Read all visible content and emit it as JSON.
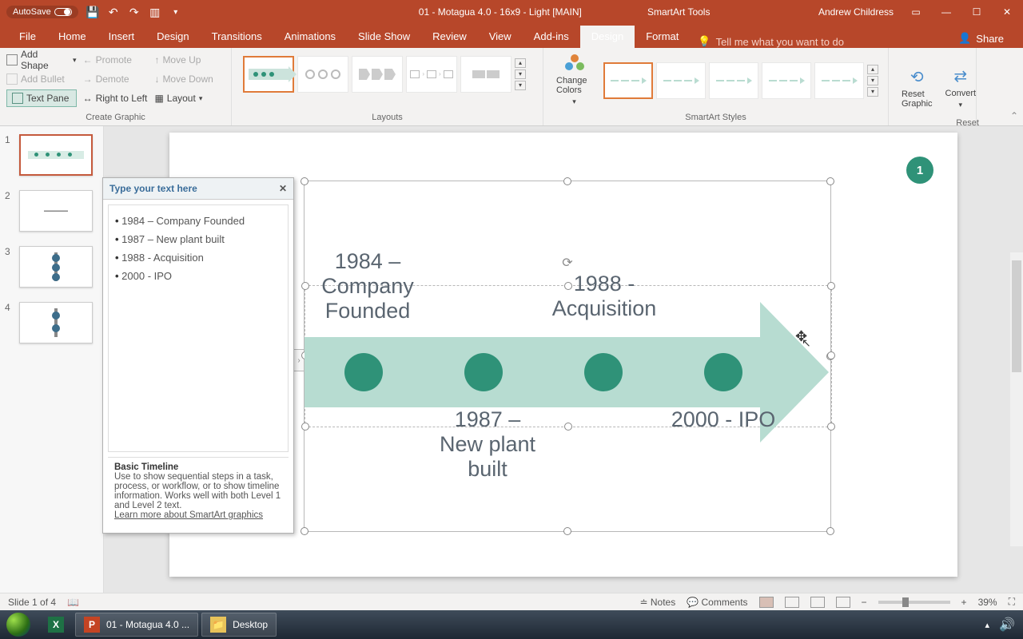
{
  "title": "01 - Motagua 4.0 - 16x9 - Light [MAIN]",
  "context_tool": "SmartArt Tools",
  "user": "Andrew Childress",
  "autosave": "AutoSave",
  "tabs": {
    "file": "File",
    "home": "Home",
    "insert": "Insert",
    "design_main": "Design",
    "transitions": "Transitions",
    "animations": "Animations",
    "slideshow": "Slide Show",
    "review": "Review",
    "view": "View",
    "addins": "Add-ins",
    "sa_design": "Design",
    "sa_format": "Format",
    "tellme": "Tell me what you want to do",
    "share": "Share"
  },
  "ribbon": {
    "add_shape": "Add Shape",
    "add_bullet": "Add Bullet",
    "text_pane": "Text Pane",
    "promote": "Promote",
    "demote": "Demote",
    "rtl": "Right to Left",
    "move_up": "Move Up",
    "move_down": "Move Down",
    "layout": "Layout",
    "group_create": "Create Graphic",
    "group_layouts": "Layouts",
    "change_colors": "Change Colors",
    "group_styles": "SmartArt Styles",
    "reset_graphic": "Reset Graphic",
    "convert": "Convert",
    "group_reset": "Reset"
  },
  "text_pane_popup": {
    "header": "Type your text here",
    "close": "✕",
    "items": [
      "1984  – Company Founded",
      "1987 – New plant built",
      "1988  - Acquisition",
      "2000  - IPO"
    ],
    "footer_title": "Basic Timeline",
    "footer_desc": "Use to show sequential steps in a task, process, or workflow, or to show timeline information. Works well with both Level 1 and Level 2 text.",
    "footer_link": "Learn more about SmartArt graphics"
  },
  "smartart": {
    "badge": "1",
    "labels": {
      "a": "1984 – Company Founded",
      "b": "1987 – New plant built",
      "c": "1988 - Acquisition",
      "d": "2000 - IPO"
    }
  },
  "status": {
    "slide": "Slide 1 of 4",
    "notes": "Notes",
    "comments": "Comments",
    "zoom": "39%"
  },
  "taskbar": {
    "pp": "01 - Motagua 4.0 ...",
    "desktop": "Desktop"
  }
}
